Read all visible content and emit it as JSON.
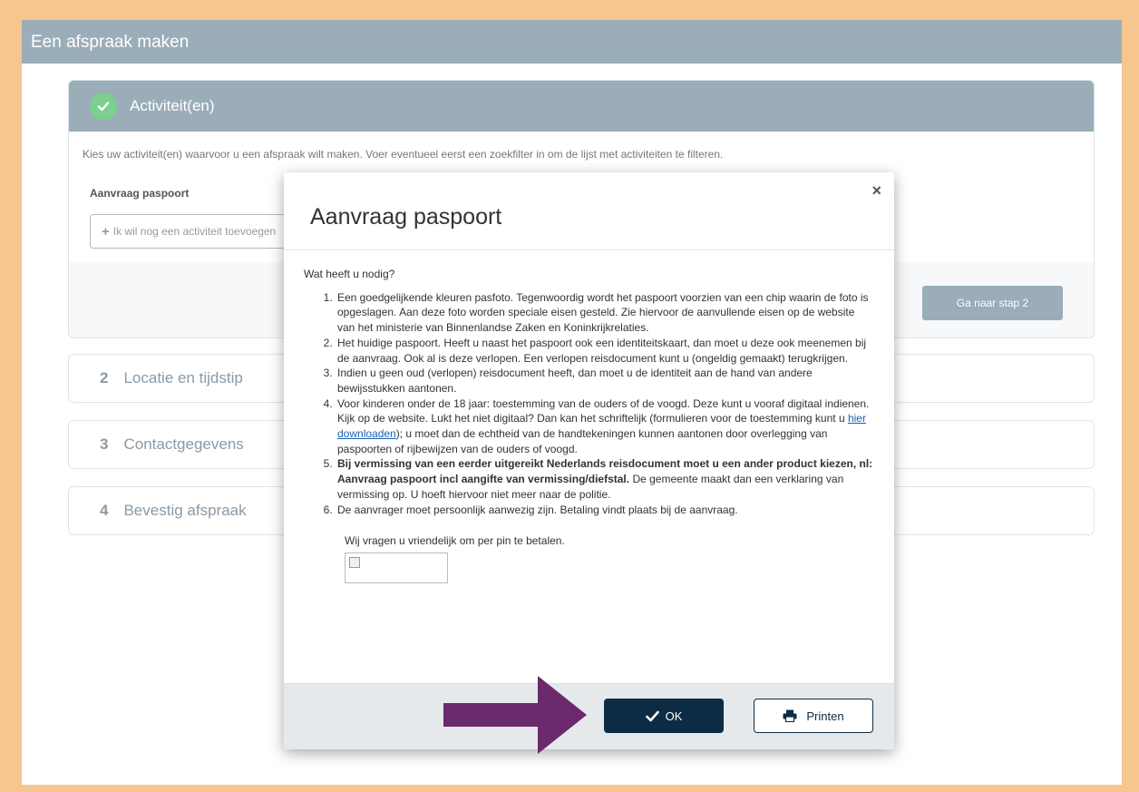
{
  "header": {
    "title": "Een afspraak maken"
  },
  "step1": {
    "title": "Activiteit(en)",
    "intro": "Kies uw activiteit(en) waarvoor u een afspraak wilt maken. Voer eventueel eerst een zoekfilter in om de lijst met activiteiten te filteren.",
    "activity_label": "Aanvraag paspoort",
    "add_activity_label": "Ik wil nog een activiteit toevoegen",
    "next_button": "Ga naar stap 2"
  },
  "steps": [
    {
      "number": "2",
      "label": "Locatie en tijdstip"
    },
    {
      "number": "3",
      "label": "Contactgegevens"
    },
    {
      "number": "4",
      "label": "Bevestig afspraak"
    }
  ],
  "modal": {
    "title": "Aanvraag paspoort",
    "close_glyph": "×",
    "question": "Wat heeft u nodig?",
    "items": {
      "i1": "Een goedgelijkende kleuren pasfoto. Tegenwoordig wordt het paspoort voorzien van een chip waarin de foto is opgeslagen. Aan deze foto worden speciale eisen gesteld. Zie hiervoor de aanvullende eisen op de website van het ministerie van Binnenlandse Zaken en Koninkrijkrelaties.",
      "i2": "Het huidige paspoort. Heeft u naast het paspoort ook een identiteitskaart, dan moet u deze ook meenemen bij de aanvraag. Ook al is deze verlopen. Een verlopen reisdocument kunt u (ongeldig gemaakt) terugkrijgen.",
      "i3": "Indien u geen oud (verlopen) reisdocument heeft, dan moet u de identiteit aan de hand van andere bewijsstukken aantonen.",
      "i4_before": "Voor kinderen onder de 18 jaar:  toestemming van de ouders of de voogd. Deze kunt u vooraf digitaal indienen. Kijk op de website. Lukt het niet digitaal? Dan kan het schriftelijk (formulieren voor de toestemming kunt u ",
      "i4_link": "hier downloaden",
      "i4_after": "); u moet dan de echtheid van de handtekeningen kunnen aantonen door overlegging van paspoorten of rijbewijzen van de ouders of voogd.",
      "i5_bold": "Bij vermissing van een eerder uitgereikt Nederlands reisdocument moet u een ander product kiezen, nl: Aanvraag paspoort incl aangifte van vermissing/diefstal.",
      "i5_rest": " De gemeente maakt dan een verklaring van vermissing op. U hoeft hiervoor niet meer naar de politie.",
      "i6": "De aanvrager moet persoonlijk aanwezig zijn. Betaling vindt plaats bij de aanvraag."
    },
    "closing": "Wij vragen u vriendelijk om per pin te betalen.",
    "ok_label": "OK",
    "print_label": "Printen"
  },
  "colors": {
    "header_bg": "#9aadb9",
    "ok_button_bg": "#0d2b45",
    "arrow": "#6b2a6b",
    "check_green": "#7ccf8e"
  }
}
